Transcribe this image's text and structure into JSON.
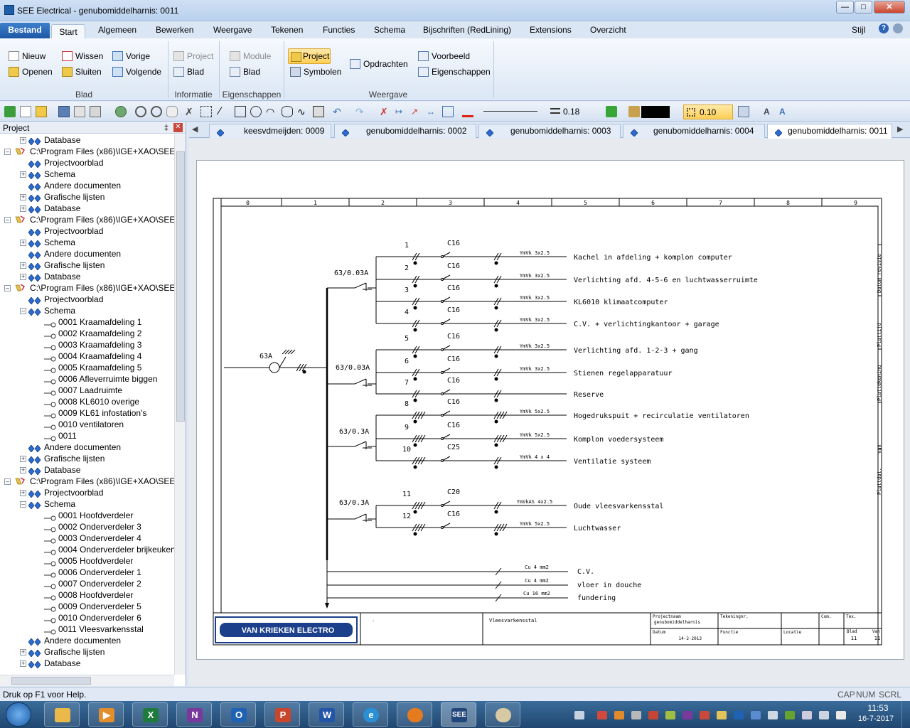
{
  "window": {
    "title": "SEE Electrical - genubomiddelharnis: 0011"
  },
  "menu": {
    "tabs": [
      "Bestand",
      "Start",
      "Algemeen",
      "Bewerken",
      "Weergave",
      "Tekenen",
      "Functies",
      "Schema",
      "Bijschriften (RedLining)",
      "Extensions",
      "Overzicht"
    ],
    "right": "Stijl"
  },
  "ribbon": {
    "blad": {
      "nieuw": "Nieuw",
      "openen": "Openen",
      "wissen": "Wissen",
      "sluiten": "Sluiten",
      "vorige": "Vorige",
      "volgende": "Volgende",
      "label": "Blad"
    },
    "informatie": {
      "project": "Project",
      "blad": "Blad",
      "label": "Informatie"
    },
    "eigenschappen": {
      "module": "Module",
      "blad": "Blad",
      "label": "Eigenschappen"
    },
    "weergave": {
      "project": "Project",
      "symbolen": "Symbolen",
      "opdrachten": "Opdrachten",
      "voorbeeld": "Voorbeeld",
      "eigenschappen": "Eigenschappen",
      "label": "Weergave"
    }
  },
  "toolbar": {
    "line_width": "0.18",
    "grid": "0.10"
  },
  "panel": {
    "title": "Project",
    "tree": [
      {
        "label": "Database",
        "level": 1,
        "icon": "db",
        "exp": "+"
      },
      {
        "label": "C:\\Program Files (x86)\\IGE+XAO\\SEE Elect",
        "level": 0,
        "icon": "proj",
        "exp": "-"
      },
      {
        "label": "Projectvoorblad",
        "level": 1,
        "icon": "db",
        "exp": ""
      },
      {
        "label": "Schema",
        "level": 1,
        "icon": "db",
        "exp": "+"
      },
      {
        "label": "Andere documenten",
        "level": 1,
        "icon": "db",
        "exp": ""
      },
      {
        "label": "Grafische lijsten",
        "level": 1,
        "icon": "db",
        "exp": "+"
      },
      {
        "label": "Database",
        "level": 1,
        "icon": "db",
        "exp": "+"
      },
      {
        "label": "C:\\Program Files (x86)\\IGE+XAO\\SEE Elect",
        "level": 0,
        "icon": "proj",
        "exp": "-"
      },
      {
        "label": "Projectvoorblad",
        "level": 1,
        "icon": "db",
        "exp": ""
      },
      {
        "label": "Schema",
        "level": 1,
        "icon": "db",
        "exp": "+"
      },
      {
        "label": "Andere documenten",
        "level": 1,
        "icon": "db",
        "exp": ""
      },
      {
        "label": "Grafische lijsten",
        "level": 1,
        "icon": "db",
        "exp": "+"
      },
      {
        "label": "Database",
        "level": 1,
        "icon": "db",
        "exp": "+"
      },
      {
        "label": "C:\\Program Files (x86)\\IGE+XAO\\SEE Elect",
        "level": 0,
        "icon": "proj",
        "exp": "-"
      },
      {
        "label": "Projectvoorblad",
        "level": 1,
        "icon": "db",
        "exp": ""
      },
      {
        "label": "Schema",
        "level": 1,
        "icon": "db",
        "exp": "-"
      },
      {
        "label": "0001 Kraamafdeling 1",
        "level": 2,
        "icon": "page",
        "exp": ""
      },
      {
        "label": "0002 Kraamafdeling 2",
        "level": 2,
        "icon": "page",
        "exp": ""
      },
      {
        "label": "0003 Kraamafdeling 3",
        "level": 2,
        "icon": "page",
        "exp": ""
      },
      {
        "label": "0004 Kraamafdeling 4",
        "level": 2,
        "icon": "page",
        "exp": ""
      },
      {
        "label": "0005 Kraamafdeling 5",
        "level": 2,
        "icon": "page",
        "exp": ""
      },
      {
        "label": "0006 Afleverruimte biggen",
        "level": 2,
        "icon": "page",
        "exp": ""
      },
      {
        "label": "0007 Laadruimte",
        "level": 2,
        "icon": "page",
        "exp": ""
      },
      {
        "label": "0008 KL6010 overige",
        "level": 2,
        "icon": "page",
        "exp": ""
      },
      {
        "label": "0009 KL61 infostation's",
        "level": 2,
        "icon": "page",
        "exp": ""
      },
      {
        "label": "0010 ventilatoren",
        "level": 2,
        "icon": "page",
        "exp": ""
      },
      {
        "label": "0011",
        "level": 2,
        "icon": "page",
        "exp": ""
      },
      {
        "label": "Andere documenten",
        "level": 1,
        "icon": "db",
        "exp": ""
      },
      {
        "label": "Grafische lijsten",
        "level": 1,
        "icon": "db",
        "exp": "+"
      },
      {
        "label": "Database",
        "level": 1,
        "icon": "db",
        "exp": "+"
      },
      {
        "label": "C:\\Program Files (x86)\\IGE+XAO\\SEE Elect",
        "level": 0,
        "icon": "proj",
        "exp": "-"
      },
      {
        "label": "Projectvoorblad",
        "level": 1,
        "icon": "db",
        "exp": "+"
      },
      {
        "label": "Schema",
        "level": 1,
        "icon": "db",
        "exp": "-"
      },
      {
        "label": "0001 Hoofdverdeler",
        "level": 2,
        "icon": "page",
        "exp": ""
      },
      {
        "label": "0002 Onderverdeler 3",
        "level": 2,
        "icon": "page",
        "exp": ""
      },
      {
        "label": "0003 Onderverdeler 4",
        "level": 2,
        "icon": "page",
        "exp": ""
      },
      {
        "label": "0004 Onderverdeler brijkeuken",
        "level": 2,
        "icon": "page",
        "exp": ""
      },
      {
        "label": "0005 Hoofdverdeler",
        "level": 2,
        "icon": "page",
        "exp": ""
      },
      {
        "label": "0006 Onderverdeler 1",
        "level": 2,
        "icon": "page",
        "exp": ""
      },
      {
        "label": "0007 Onderverdeler 2",
        "level": 2,
        "icon": "page",
        "exp": ""
      },
      {
        "label": "0008 Hoofdverdeler",
        "level": 2,
        "icon": "page",
        "exp": ""
      },
      {
        "label": "0009 Onderverdeler 5",
        "level": 2,
        "icon": "page",
        "exp": ""
      },
      {
        "label": "0010 Onderverdeler 6",
        "level": 2,
        "icon": "page",
        "exp": ""
      },
      {
        "label": "0011 Vleesvarkensstal",
        "level": 2,
        "icon": "page",
        "exp": ""
      },
      {
        "label": "Andere documenten",
        "level": 1,
        "icon": "db",
        "exp": ""
      },
      {
        "label": "Grafische lijsten",
        "level": 1,
        "icon": "db",
        "exp": "+"
      },
      {
        "label": "Database",
        "level": 1,
        "icon": "db",
        "exp": "+"
      }
    ]
  },
  "doc_tabs": [
    "keesvdmeijden: 0009",
    "genubomiddelharnis: 0002",
    "genubomiddelharnis: 0003",
    "genubomiddelharnis: 0004",
    "genubomiddelharnis: 0011"
  ],
  "drawing": {
    "columns": [
      "0",
      "1",
      "2",
      "3",
      "4",
      "5",
      "6",
      "7",
      "8",
      "9"
    ],
    "main_breaker": "63A",
    "groups": [
      "63/0.03A",
      "63/0.03A",
      "63/0.3A",
      "63/0.3A"
    ],
    "circuits": [
      {
        "n": "1",
        "fuse": "C16",
        "cable": "YmVk 3x2.5",
        "desc": "Kachel in afdeling + komplon computer"
      },
      {
        "n": "2",
        "fuse": "C16",
        "cable": "YmVk 3x2.5",
        "desc": "Verlichting afd. 4-5-6 en luchtwasserruimte"
      },
      {
        "n": "3",
        "fuse": "C16",
        "cable": "YmVk 3x2.5",
        "desc": "KL6010 klimaatcomputer"
      },
      {
        "n": "4",
        "fuse": "C16",
        "cable": "YmVk 3x2.5",
        "desc": "C.V. + verlichtingkantoor + garage"
      },
      {
        "n": "5",
        "fuse": "C16",
        "cable": "YmVk 3x2.5",
        "desc": "Verlichting afd. 1-2-3 + gang"
      },
      {
        "n": "6",
        "fuse": "C16",
        "cable": "YmVk 3x2.5",
        "desc": "Stienen regelapparatuur"
      },
      {
        "n": "7",
        "fuse": "C16",
        "cable": "",
        "desc": "Reserve"
      },
      {
        "n": "8",
        "fuse": "C16",
        "cable": "YmVk 5x2.5",
        "desc": "Hogedrukspuit + recirculatie ventilatoren"
      },
      {
        "n": "9",
        "fuse": "C16",
        "cable": "YmVk 5x2.5",
        "desc": "Komplon voedersysteem"
      },
      {
        "n": "10",
        "fuse": "C25",
        "cable": "YmVk 4 x 4",
        "desc": "Ventilatie systeem"
      },
      {
        "n": "11",
        "fuse": "C20",
        "cable": "YmVkAS 4x2.5",
        "desc": "Oude vleesvarkensstal"
      },
      {
        "n": "12",
        "fuse": "C16",
        "cable": "YmVk 5x2.5",
        "desc": "Luchtwasser"
      }
    ],
    "earth": [
      {
        "cable": "Cu 4 mm2",
        "desc": "C.V."
      },
      {
        "cable": "Cu 4 mm2",
        "desc": "vloer in douche"
      },
      {
        "cable": "Cu 16 mm2",
        "desc": "fundering"
      }
    ],
    "side_labels": [
      "Datum revisie",
      "Plattijd",
      "Plattekening",
      "van",
      "Plattdat."
    ],
    "titleblock": {
      "logo": "VAN KRIEKEN ELECTRO",
      "dot": ".",
      "name": "Vleesvarkensstal",
      "projlabel": "Projectnaam",
      "projname": "genubomiddelharnis",
      "tek": "Tekeningnr.",
      "com": "Com.",
      "tex": "Tex.",
      "datum_label": "Datum",
      "datum": "14-2-2013",
      "functie": "Functie",
      "locatie": "Locatie",
      "blad_label": "Blad",
      "blad": "11",
      "van_label": "Van",
      "van": "11"
    }
  },
  "status": {
    "help": "Druk op F1 voor Help.",
    "cap": "CAP",
    "num": "NUM",
    "scrl": "SCRL"
  },
  "taskbar": {
    "apps": [
      "Verkenner",
      "Media",
      "X",
      "N",
      "O",
      "P",
      "W",
      "Internet",
      "Firefox",
      "SEE",
      "Paint"
    ],
    "time": "11:53",
    "date": "16-7-2017"
  }
}
